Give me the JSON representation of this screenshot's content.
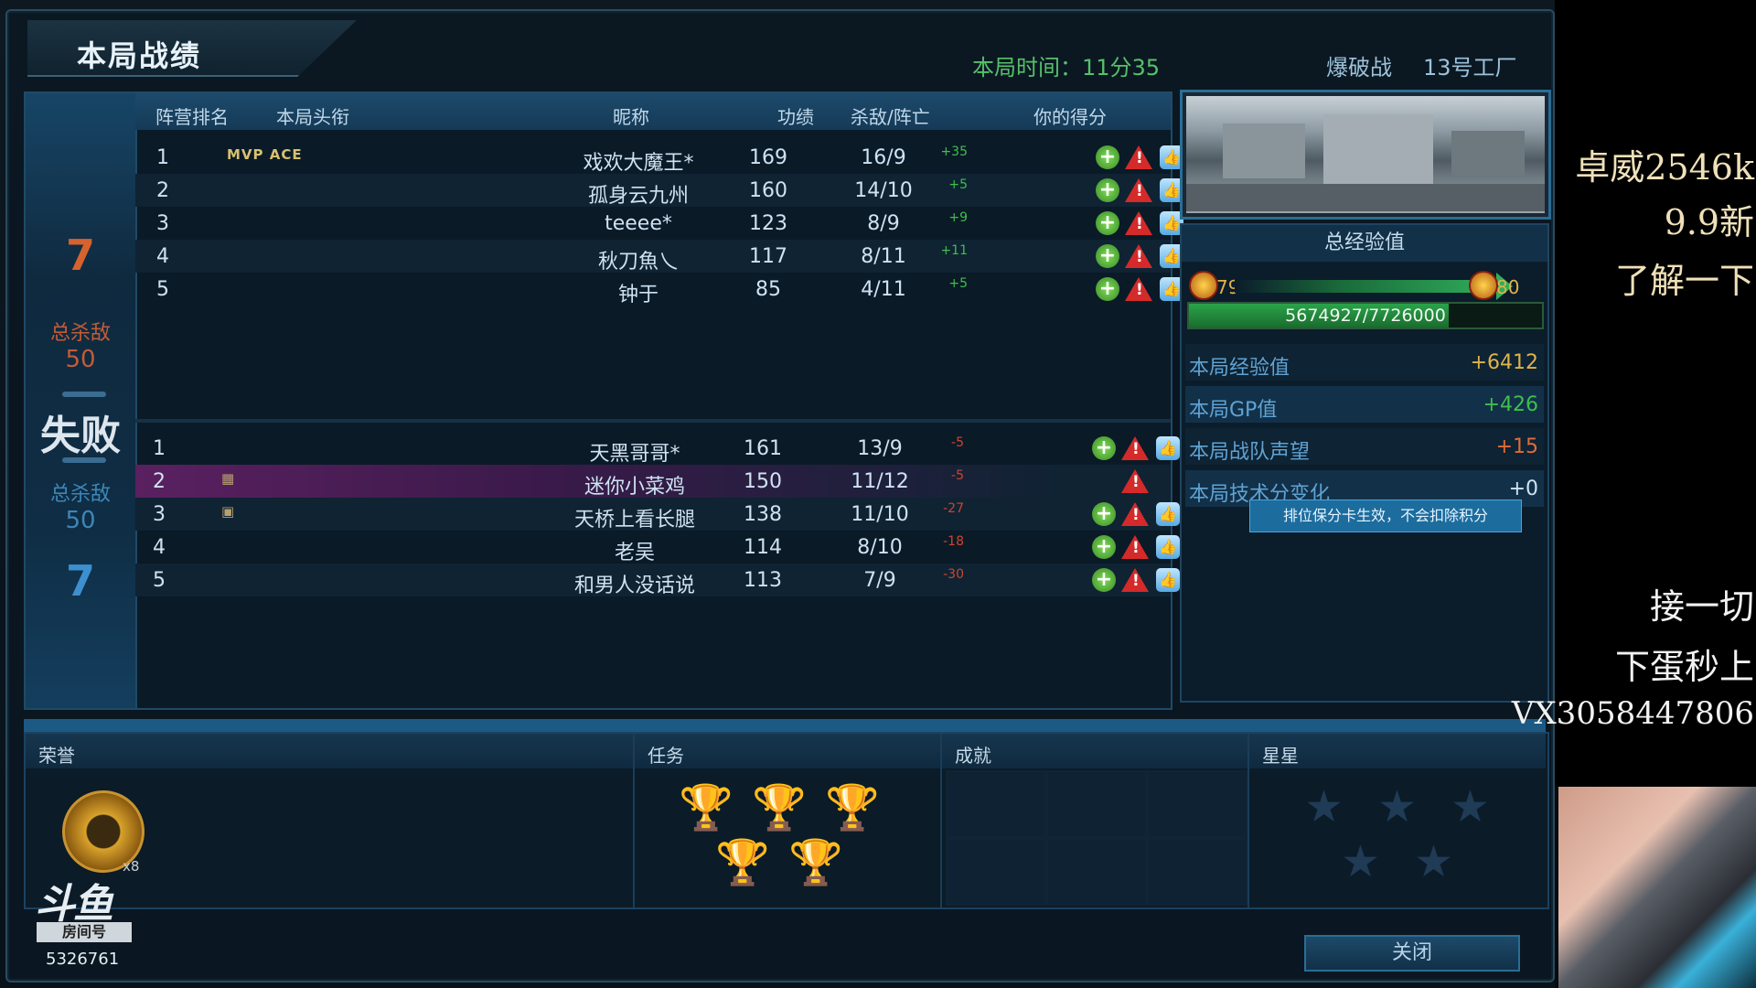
{
  "window": {
    "title": "本局战绩",
    "round_time": "本局时间：11分35",
    "mode": "爆破战",
    "map": "13号工厂"
  },
  "headers": {
    "camp_rank": "阵营排名",
    "title": "本局头衔",
    "nickname": "昵称",
    "merit": "功绩",
    "kd": "杀敌/阵亡",
    "your_score": "你的得分"
  },
  "side": {
    "team1_score": "7",
    "team1_kills_label": "总杀敌",
    "team1_kills": "50",
    "result": "失败",
    "team2_kills_label": "总杀敌",
    "team2_kills": "50",
    "team2_score": "7"
  },
  "team1": [
    {
      "rank": "1",
      "badges": "MVP ACE",
      "nick": "戏欢大魔王*",
      "merit": "169",
      "kd": "16/9",
      "delta": "+35"
    },
    {
      "rank": "2",
      "badges": "",
      "nick": "孤身云九州",
      "merit": "160",
      "kd": "14/10",
      "delta": "+5"
    },
    {
      "rank": "3",
      "badges": "",
      "nick": "teeee*",
      "merit": "123",
      "kd": "8/9",
      "delta": "+9"
    },
    {
      "rank": "4",
      "badges": "",
      "nick": "秋刀魚乀",
      "merit": "117",
      "kd": "8/11",
      "delta": "+11"
    },
    {
      "rank": "5",
      "badges": "",
      "nick": "钟于",
      "merit": "85",
      "kd": "4/11",
      "delta": "+5"
    }
  ],
  "team2": [
    {
      "rank": "1",
      "nick": "天黑哥哥*",
      "merit": "161",
      "kd": "13/9",
      "delta": "-5"
    },
    {
      "rank": "2",
      "nick": "迷你小菜鸡",
      "merit": "150",
      "kd": "11/12",
      "delta": "-5"
    },
    {
      "rank": "3",
      "nick": "天桥上看长腿",
      "merit": "138",
      "kd": "11/10",
      "delta": "-27"
    },
    {
      "rank": "4",
      "nick": "老吴",
      "merit": "114",
      "kd": "8/10",
      "delta": "-18"
    },
    {
      "rank": "5",
      "nick": "和男人没话说",
      "merit": "113",
      "kd": "7/9",
      "delta": "-30"
    }
  ],
  "xp": {
    "title": "总经验值",
    "level_from": "79",
    "level_to": "80",
    "progress_text": "5674927/7726000",
    "progress_fraction": 0.7345,
    "round_xp_label": "本局经验值",
    "round_xp": "+6412",
    "round_gp_label": "本局GP值",
    "round_gp": "+426",
    "clan_label": "本局战队声望",
    "clan": "+15",
    "skill_label": "本局技术分变化",
    "skill": "+0",
    "tooltip": "排位保分卡生效，不会扣除积分"
  },
  "bottom": {
    "honor": "荣誉",
    "honor_count": "x8",
    "task": "任务",
    "achievement": "成就",
    "stars": "星星"
  },
  "close_label": "关闭",
  "logo": {
    "brand": "斗鱼",
    "room_label": "房间号",
    "room_id": "5326761"
  },
  "overlay": {
    "line1": "卓威2546k",
    "line2": "9.9新",
    "line3": "了解一下",
    "line4": "接一切",
    "line5": "下蛋秒上",
    "line6": "VX3058447806"
  },
  "colors": {
    "positive": "#3fbf4c",
    "negative": "#d0442f",
    "team_red": "#c35b38",
    "team_blue": "#3d86b8",
    "time_green": "#57c06a"
  }
}
